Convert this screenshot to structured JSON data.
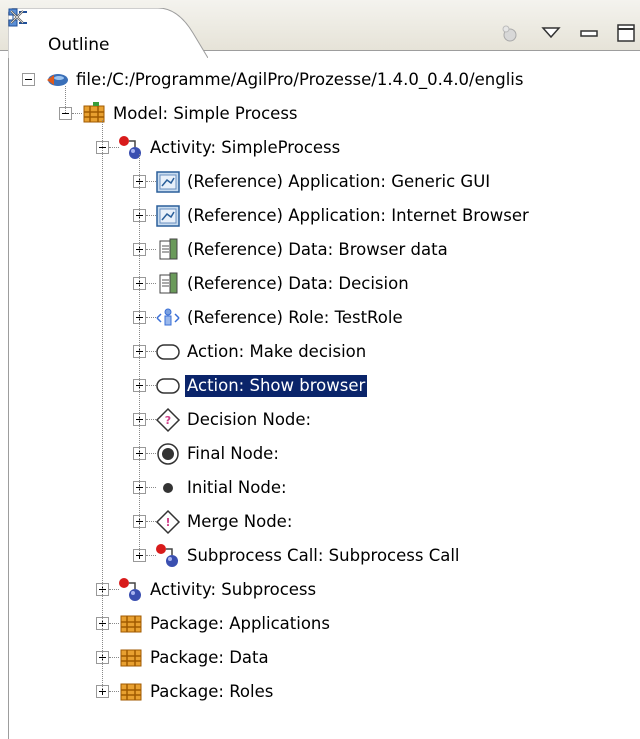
{
  "view": {
    "tab_title": "Outline"
  },
  "tree": [
    {
      "label": "file:/C:/Programme/AgilPro/Prozesse/1.4.0_0.4.0/englis",
      "icon": "file-resource-icon",
      "depth": 0,
      "state": "minus"
    },
    {
      "label": "Model: Simple Process",
      "icon": "model-icon",
      "depth": 1,
      "state": "minus"
    },
    {
      "label": "Activity: SimpleProcess",
      "icon": "activity-icon",
      "depth": 2,
      "state": "minus"
    },
    {
      "label": "(Reference) Application: Generic GUI",
      "icon": "application-icon",
      "depth": 3,
      "state": "plus"
    },
    {
      "label": "(Reference) Application: Internet Browser",
      "icon": "application-icon",
      "depth": 3,
      "state": "plus"
    },
    {
      "label": "(Reference) Data: Browser data",
      "icon": "data-icon",
      "depth": 3,
      "state": "plus"
    },
    {
      "label": "(Reference) Data: Decision",
      "icon": "data-icon",
      "depth": 3,
      "state": "plus"
    },
    {
      "label": "(Reference) Role: TestRole",
      "icon": "role-icon",
      "depth": 3,
      "state": "plus"
    },
    {
      "label": "Action: Make decision",
      "icon": "action-icon",
      "depth": 3,
      "state": "plus"
    },
    {
      "label": "Action: Show browser",
      "icon": "action-icon",
      "depth": 3,
      "state": "plus",
      "selected": true
    },
    {
      "label": "Decision Node:",
      "icon": "decision-node-icon",
      "depth": 3,
      "state": "plus"
    },
    {
      "label": "Final Node:",
      "icon": "final-node-icon",
      "depth": 3,
      "state": "plus"
    },
    {
      "label": "Initial Node:",
      "icon": "initial-node-icon",
      "depth": 3,
      "state": "plus"
    },
    {
      "label": "Merge Node:",
      "icon": "merge-node-icon",
      "depth": 3,
      "state": "plus"
    },
    {
      "label": "Subprocess Call: Subprocess Call",
      "icon": "activity-icon",
      "depth": 3,
      "state": "plus"
    },
    {
      "label": "Activity: Subprocess",
      "icon": "activity-icon",
      "depth": 2,
      "state": "plus"
    },
    {
      "label": "Package: Applications",
      "icon": "package-icon",
      "depth": 2,
      "state": "plus"
    },
    {
      "label": "Package: Data",
      "icon": "package-icon",
      "depth": 2,
      "state": "plus"
    },
    {
      "label": "Package: Roles",
      "icon": "package-icon",
      "depth": 2,
      "state": "plus"
    }
  ],
  "colors": {
    "selection": "#0a246a",
    "tab_bg": "#f4f3ee"
  }
}
